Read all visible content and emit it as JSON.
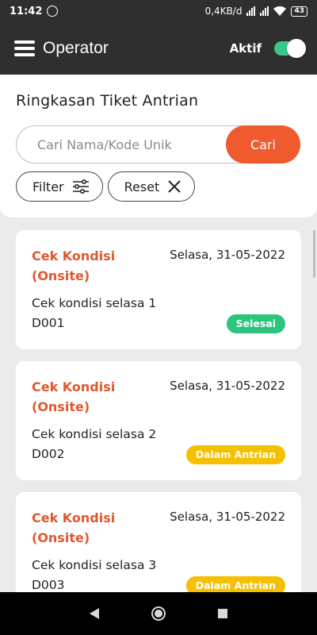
{
  "status_bar": {
    "time": "11:42",
    "net_speed": "0,4KB/d",
    "battery": "43"
  },
  "app_bar": {
    "title": "Operator",
    "active_label": "Aktif",
    "active_on": true
  },
  "search_panel": {
    "title": "Ringkasan Tiket Antrian",
    "search_placeholder": "Cari Nama/Kode Unik",
    "search_button": "Cari",
    "filter_label": "Filter",
    "reset_label": "Reset"
  },
  "tickets": [
    {
      "title": "Cek Kondisi (Onsite)",
      "date": "Selasa, 31-05-2022",
      "description": "Cek kondisi selasa 1",
      "code": "D001",
      "status": "Selesai",
      "status_color": "#2cc47f"
    },
    {
      "title": "Cek Kondisi (Onsite)",
      "date": "Selasa, 31-05-2022",
      "description": "Cek kondisi selasa 2",
      "code": "D002",
      "status": "Dalam Antrian",
      "status_color": "#f5c000"
    },
    {
      "title": "Cek Kondisi (Onsite)",
      "date": "Selasa, 31-05-2022",
      "description": "Cek kondisi selasa 3",
      "code": "D003",
      "status": "Dalam Antrian",
      "status_color": "#f5c000"
    }
  ],
  "colors": {
    "accent": "#f05a2f",
    "toggle_on": "#37c88a",
    "bar_bg": "#2f2f2f"
  }
}
